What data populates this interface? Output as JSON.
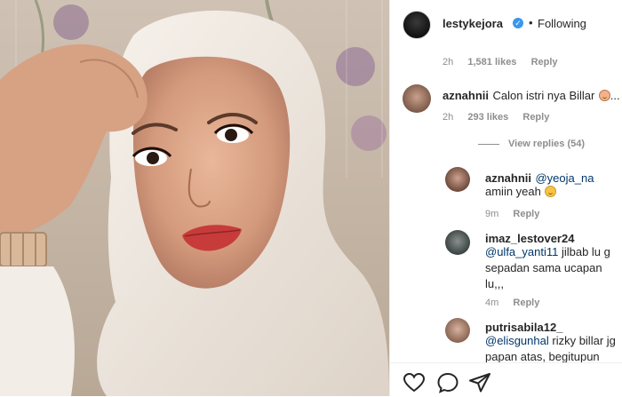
{
  "header": {
    "username": "lestykejora",
    "separator": "•",
    "follow_status": "Following"
  },
  "top_meta": {
    "time": "2h",
    "likes": "1,581 likes",
    "reply": "Reply"
  },
  "comments": [
    {
      "username": "aznahnii",
      "text": "Calon istri nya Billar",
      "trailing": "...",
      "time": "2h",
      "likes": "293 likes",
      "reply": "Reply",
      "view_replies": "View replies (54)"
    }
  ],
  "replies": [
    {
      "username": "aznahnii",
      "mention": "@yeoja_na",
      "text": "amiin yeah",
      "time": "9m",
      "reply": "Reply"
    },
    {
      "username": "imaz_lestover24",
      "mention": "@ulfa_yanti11",
      "text_line1": " jilbab lu g",
      "text_line2": "sepadan sama ucapan",
      "text_line3": "lu,,,",
      "time": "4m",
      "reply": "Reply"
    },
    {
      "username": "putrisabila12_",
      "mention": "@elisgunhal",
      "text_line1": " rizky billar jg",
      "text_line2": "papan atas, begitupun"
    }
  ],
  "icons": [
    "heart-icon",
    "comment-icon",
    "share-icon"
  ]
}
